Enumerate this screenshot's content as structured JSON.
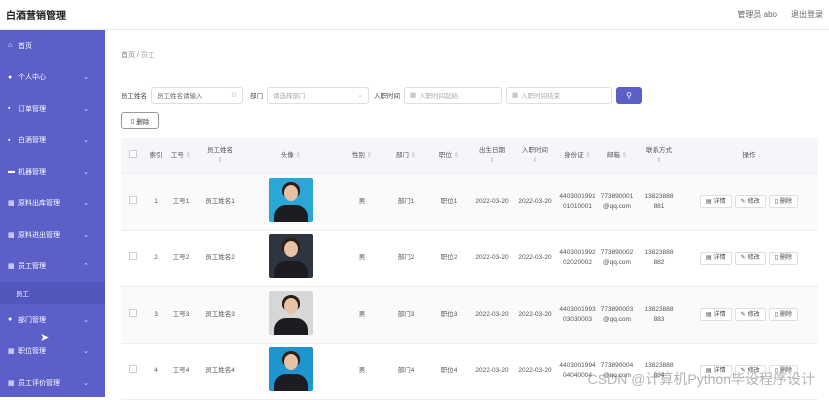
{
  "app": {
    "title": "白酒营销管理",
    "user_label": "管理员 abo",
    "logout": "退出登录"
  },
  "sidebar": {
    "items": [
      {
        "label": "首页",
        "icon": "home-icon",
        "glyph": "⌂",
        "chev": ""
      },
      {
        "label": "个人中心",
        "icon": "user-icon",
        "glyph": "●",
        "chev": "⌄"
      },
      {
        "label": "订单管理",
        "icon": "lock-icon",
        "glyph": "▪",
        "chev": "⌄"
      },
      {
        "label": "白酒管理",
        "icon": "lock-icon",
        "glyph": "▪",
        "chev": "⌄"
      },
      {
        "label": "机器管理",
        "icon": "card-icon",
        "glyph": "▬",
        "chev": "⌄"
      },
      {
        "label": "原料出库管理",
        "icon": "grid-icon",
        "glyph": "▦",
        "chev": "⌄"
      },
      {
        "label": "原料进出管理",
        "icon": "grid-icon",
        "glyph": "▦",
        "chev": "⌄"
      },
      {
        "label": "员工管理",
        "icon": "grid-icon",
        "glyph": "▦",
        "chev": "⌃"
      }
    ],
    "sub_item": "员工",
    "items_after": [
      {
        "label": "部门管理",
        "icon": "user-icon",
        "glyph": "●",
        "chev": "⌄"
      },
      {
        "label": "职位管理",
        "icon": "grid-icon",
        "glyph": "▦",
        "chev": "⌄"
      },
      {
        "label": "员工评价管理",
        "icon": "grid-icon",
        "glyph": "▦",
        "chev": "⌄"
      }
    ]
  },
  "breadcrumb": {
    "home": "首页",
    "sep": "/",
    "current": "员工"
  },
  "filters": {
    "name_label": "员工姓名",
    "name_placeholder": "员工姓名请输入",
    "dept_label": "部门",
    "dept_placeholder": "请选择部门",
    "date_label": "入职时间",
    "date_start_placeholder": "入职时间起始",
    "date_end_placeholder": "入职时间结束",
    "search_icon": "search-icon"
  },
  "toolbar": {
    "delete_label": "删除"
  },
  "table": {
    "headers": {
      "index": "索引",
      "no": "工号",
      "name": "员工姓名",
      "head": "头像",
      "sex": "性别",
      "dept": "部门",
      "pos": "职位",
      "birth": "出生日期",
      "join": "入职时间",
      "id": "身份证",
      "mail": "邮箱",
      "phone": "联系方式",
      "ops": "操作"
    },
    "rows": [
      {
        "index": "1",
        "no": "工号1",
        "name": "员工姓名1",
        "sex": "男",
        "dept": "部门1",
        "pos": "职位1",
        "birth": "2022-03-20",
        "join": "2022-03-20",
        "id": "440300199101010001",
        "mail": "773890001@qq.com",
        "phone": "13823888881"
      },
      {
        "index": "2",
        "no": "工号2",
        "name": "员工姓名2",
        "sex": "男",
        "dept": "部门2",
        "pos": "职位2",
        "birth": "2022-03-20",
        "join": "2022-03-20",
        "id": "440300199202020002",
        "mail": "773890002@qq.com",
        "phone": "13823888882"
      },
      {
        "index": "3",
        "no": "工号3",
        "name": "员工姓名3",
        "sex": "男",
        "dept": "部门3",
        "pos": "职位3",
        "birth": "2022-03-20",
        "join": "2022-03-20",
        "id": "440300199303030003",
        "mail": "773890003@qq.com",
        "phone": "13823888883"
      },
      {
        "index": "4",
        "no": "工号4",
        "name": "员工姓名4",
        "sex": "男",
        "dept": "部门4",
        "pos": "职位4",
        "birth": "2022-03-20",
        "join": "2022-03-20",
        "id": "440300199404040004",
        "mail": "773890004@qq.com",
        "phone": "13823888884"
      }
    ],
    "ops": {
      "detail": "详情",
      "edit": "修改",
      "delete": "删除"
    }
  },
  "watermark": "CSDN @计算机Python毕设程序设计"
}
